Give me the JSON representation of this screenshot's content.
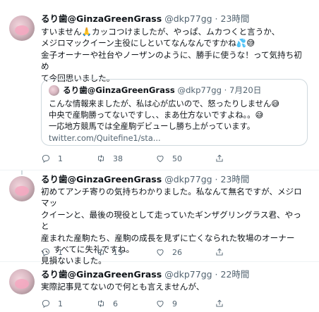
{
  "tweets": [
    {
      "name": "るり歯",
      "handle": "@GinzaGreenGrass",
      "user_id": "@dkp77gg",
      "time": "23時間",
      "text": "すいません🙏カッコつけましたが、やっぱ、ムカつくと言うか、\nメジロマックイーン主役にしといてなんなんですかね💦😅\n金子オーナーや社台やノーザンのように、勝手に使うな！って気持ち初め\nて今回思いました。",
      "quote": {
        "name": "るり歯",
        "handle": "@GinzaGreenGrass",
        "user_id": "@dkp77gg",
        "date": "7月20日",
        "text": "こんな情報来ましたが、私は心が広いので、怒ったりしません😅\n中央で産駒勝ってないですし、、まあ仕方ないですよね。。😅\n一応地方競馬では全産駒デビューし勝ち上がっています。",
        "link": "twitter.com/Quitefine1/sta..."
      },
      "replies": "1",
      "retweets": "38",
      "likes": "50"
    },
    {
      "name": "るり歯",
      "handle": "@GinzaGreenGrass",
      "user_id": "@dkp77gg",
      "time": "23時間",
      "text": "初めてアンチ寄りの気持ちわかりました。私なんて無名ですが、メジロマッ\nクイーンと、最後の現役として走っていたギンザグリングラス君、やっと\n産まれた産駒たち、産駒の成長を見ずに亡くなられた牧場のオーナー\n、、すべてに失礼ですね。\n見損ないました。",
      "replies": "1",
      "retweets": "15",
      "likes": "26"
    },
    {
      "name": "るり歯",
      "handle": "@GinzaGreenGrass",
      "user_id": "@dkp77gg",
      "time": "22時間",
      "text": "実際記事見てないので何とも言えませんが、",
      "replies": "1",
      "retweets": "6",
      "likes": "9"
    }
  ],
  "icons": {
    "reply": "reply-icon",
    "retweet": "retweet-icon",
    "like": "heart-icon",
    "share": "share-icon"
  }
}
